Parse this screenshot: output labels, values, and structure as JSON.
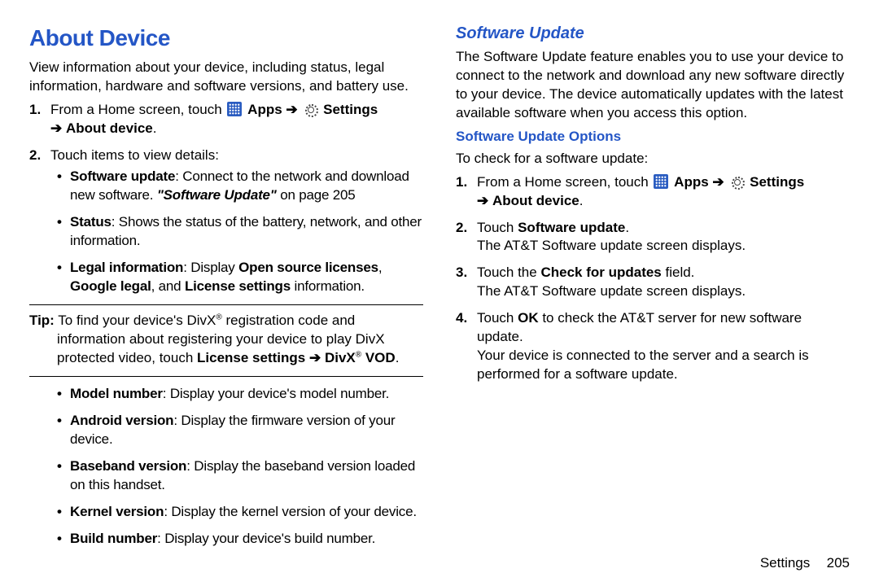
{
  "h1": "About Device",
  "intro": "View information about your device, including status, legal information, hardware and software versions, and battery use.",
  "s1_a": "From a Home screen, touch",
  "apps": "Apps",
  "arrow": "➔",
  "settings": "Settings",
  "about_device": "About device",
  "s2": "Touch items to view details:",
  "b1_t": "Software update",
  "b1_r": ": Connect to the network and download new software. ",
  "b1_ref": "\"Software Update\"",
  "b1_pg": " on page 205",
  "b2_t": "Status",
  "b2_r": ": Shows the status of the battery, network, and other information.",
  "b3_t": "Legal information",
  "b3_a": ": Display ",
  "b3_b1": "Open source licenses",
  "b3_c": ", ",
  "b3_b2": "Google legal",
  "b3_d": ", and ",
  "b3_b3": "License settings",
  "b3_e": " information.",
  "tip_lbl": "Tip:",
  "tip_l1a": "To find your device's DivX",
  "tip_l1b": " registration code and",
  "tip_l2": "information about registering your device to play DivX",
  "tip_l3a": "protected video, touch ",
  "tip_b1": "License settings",
  "tip_b2": "DivX",
  "tip_b3": " VOD",
  "m1_t": "Model number",
  "m1_r": ": Display your device's model number.",
  "m2_t": "Android version",
  "m2_r": ": Display the firmware version of your device.",
  "m3_t": "Baseband version",
  "m3_r": ": Display the baseband version loaded on this handset.",
  "m4_t": "Kernel version",
  "m4_r": ": Display the kernel version of your device.",
  "m5_t": "Build number",
  "m5_r": ": Display your device's build number.",
  "h2": "Software Update",
  "su_p": "The Software Update feature enables you to use your device to connect to the network and download any new software directly to your device. The device automatically updates with the latest available software when you access this option.",
  "h3": "Software Update Options",
  "chk": "To check for a software update:",
  "o2a": "Touch ",
  "o2b": "Software update",
  "o2c": ".",
  "o2d": "The AT&T Software update screen displays.",
  "o3a": "Touch the ",
  "o3b": "Check for updates",
  "o3c": " field.",
  "o3d": "The AT&T Software update screen displays.",
  "o4a": "Touch ",
  "o4b": "OK",
  "o4c": " to check the AT&T server for new software update.",
  "o4d": "Your device is connected to the server and a search is performed for a software update.",
  "foot_section": "Settings",
  "foot_page": "205",
  "period": "."
}
